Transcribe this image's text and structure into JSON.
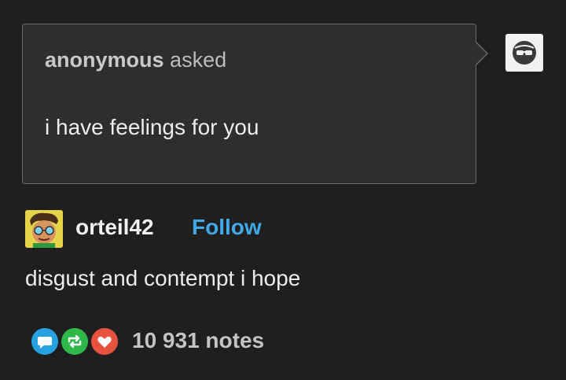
{
  "ask": {
    "asker_name": "anonymous",
    "asked_label": "asked",
    "question": "i have feelings for you"
  },
  "answer": {
    "username": "orteil42",
    "follow_label": "Follow",
    "text": "disgust and contempt i hope"
  },
  "notes": {
    "count_label": "10 931 notes"
  },
  "icons": {
    "anon_avatar": "anon-sunglasses-icon",
    "reply": "reply-bubble-icon",
    "reblog": "reblog-icon",
    "like": "heart-icon"
  },
  "colors": {
    "background": "#1f1f1f",
    "ask_bubble": "#2e2e2e",
    "follow": "#40a9e8",
    "reply": "#27a2e0",
    "reblog": "#2fb84a",
    "like": "#e8533f"
  }
}
